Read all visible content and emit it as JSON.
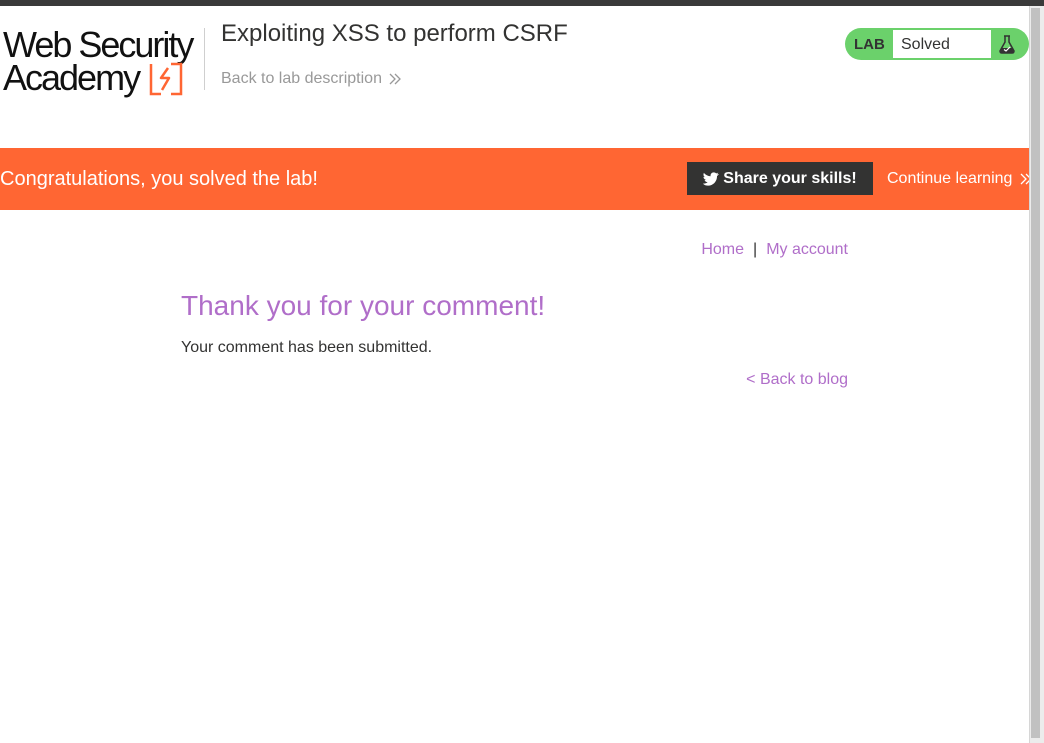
{
  "header": {
    "logo": {
      "line1": "Web Security",
      "line2": "Academy",
      "icon": "lightning-bolt-logo-icon",
      "accent": "#ff6633"
    },
    "lab_title": "Exploiting XSS to perform CSRF",
    "back_link": "Back to lab description",
    "back_icon": "double-chevron-right-icon",
    "lab_status": {
      "tag": "LAB",
      "status": "Solved",
      "icon": "flask-icon",
      "color": "#6bd16b"
    }
  },
  "banner": {
    "message": "Congratulations, you solved the lab!",
    "share_label": "Share your skills!",
    "share_icon": "twitter-icon",
    "continue_label": "Continue learning",
    "continue_icon": "double-chevron-right-icon",
    "color": "#ff6633"
  },
  "nav": {
    "home": "Home",
    "separator": "|",
    "account": "My account",
    "link_color": "#b06ec9"
  },
  "content": {
    "heading": "Thank you for your comment!",
    "message": "Your comment has been submitted.",
    "back_link": "< Back to blog"
  }
}
